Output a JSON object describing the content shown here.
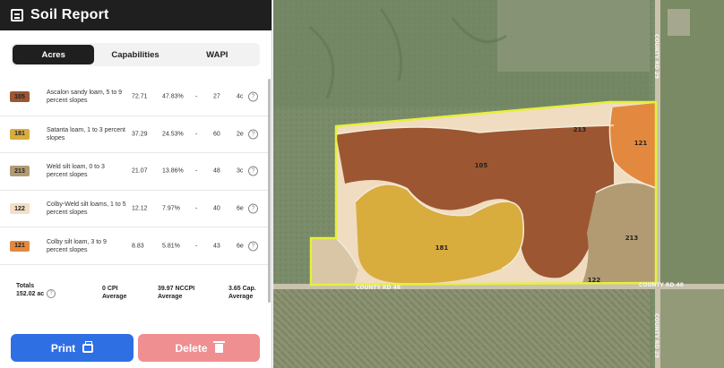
{
  "header": {
    "title": "Soil Report",
    "icon": "report-icon"
  },
  "tabs": [
    {
      "label": "Acres",
      "active": true
    },
    {
      "label": "Capabilities",
      "active": false
    },
    {
      "label": "WAPI",
      "active": false
    }
  ],
  "soils": [
    {
      "code": "105",
      "name": "Ascalon sandy loam, 5 to 9 percent slopes",
      "acres": "72.71",
      "pct": "47.83%",
      "dash": "-",
      "num": "27",
      "cap": "4c",
      "color": "#9c5632"
    },
    {
      "code": "181",
      "name": "Satanta loam, 1 to 3 percent slopes",
      "acres": "37.29",
      "pct": "24.53%",
      "dash": "-",
      "num": "60",
      "cap": "2e",
      "color": "#d9ac3e"
    },
    {
      "code": "213",
      "name": "Weld silt loam, 0 to 3 percent slopes",
      "acres": "21.07",
      "pct": "13.86%",
      "dash": "-",
      "num": "48",
      "cap": "3c",
      "color": "#b29b73"
    },
    {
      "code": "122",
      "name": "Colby-Weld silt loams, 1 to 5 percent slopes",
      "acres": "12.12",
      "pct": "7.97%",
      "dash": "-",
      "num": "40",
      "cap": "6e",
      "color": "#f2dfc6"
    },
    {
      "code": "121",
      "name": "Colby silt loam, 3 to 9 percent slopes",
      "acres": "8.83",
      "pct": "5.81%",
      "dash": "-",
      "num": "43",
      "cap": "6e",
      "color": "#e3893f"
    }
  ],
  "totals": {
    "label": "Totals",
    "acres": "152.02 ac",
    "cpi_value": "0 CPI",
    "cpi_sub": "Average",
    "nccpi_value": "39.97 NCCPI",
    "nccpi_sub": "Average",
    "cap_value": "3.65 Cap.",
    "cap_sub": "Average"
  },
  "buttons": {
    "print": "Print",
    "delete": "Delete"
  },
  "map": {
    "roads": {
      "county_rd_48_a": "COUNTY RD 48",
      "county_rd_48_b": "COUNTY RD 48",
      "county_rd_29_a": "COUNTY RD 29",
      "county_rd_29_b": "COUNTY RD 29"
    },
    "labels": {
      "z105": "105",
      "z181": "181",
      "z213": "213",
      "z122": "122",
      "z121": "121",
      "z213b": "213"
    },
    "boundary_color": "#e6f03a"
  }
}
